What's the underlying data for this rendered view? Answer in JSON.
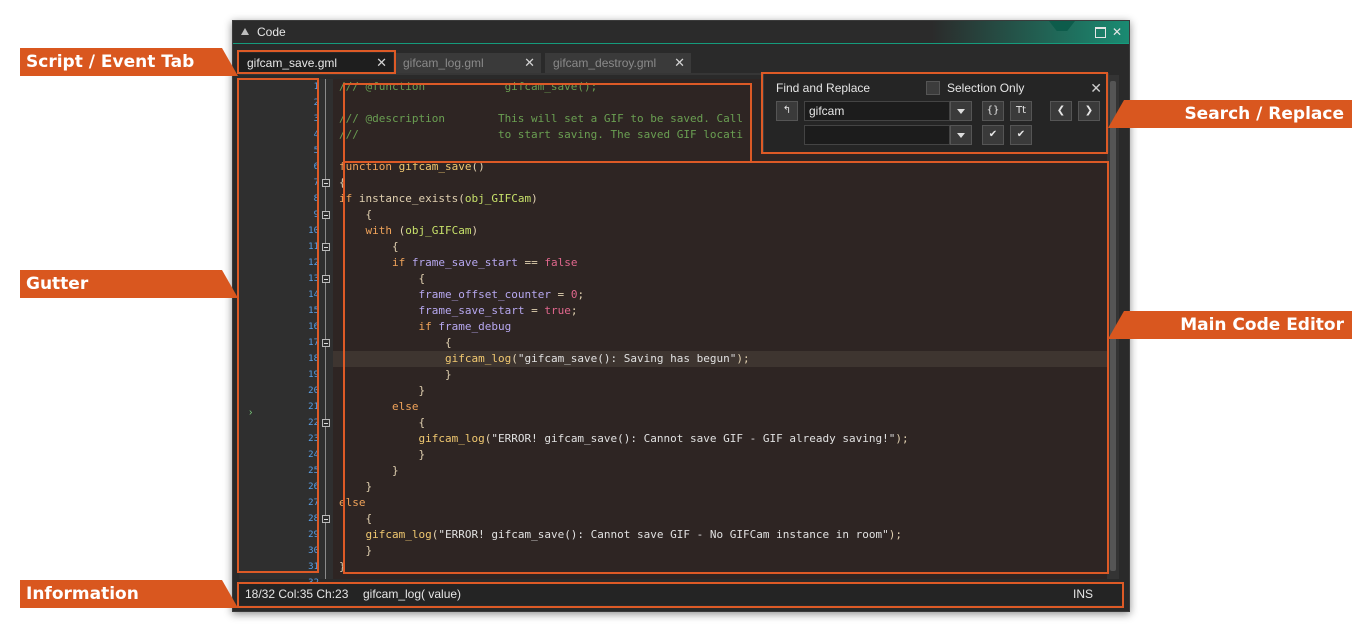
{
  "window": {
    "title": "Code",
    "close_glyph": "✕"
  },
  "tabs": [
    {
      "label": "gifcam_save.gml",
      "close": "✕",
      "active": true
    },
    {
      "label": "gifcam_log.gml",
      "close": "✕",
      "active": false
    },
    {
      "label": "gifcam_destroy.gml",
      "close": "✕",
      "active": false
    }
  ],
  "line_numbers": [
    "1",
    "2",
    "3",
    "4",
    "5",
    "6",
    "7",
    "8",
    "9",
    "10",
    "11",
    "12",
    "13",
    "14",
    "15",
    "16",
    "17",
    "18",
    "19",
    "20",
    "21",
    "22",
    "23",
    "24",
    "25",
    "26",
    "27",
    "28",
    "29",
    "30",
    "31",
    "32"
  ],
  "code_lines": [
    "/// @function            gifcam_save();",
    "",
    "/// @description        This will set a GIF to be saved. Call",
    "///                     to start saving. The saved GIF locati",
    "",
    "function gifcam_save()",
    "{",
    "if instance_exists(obj_GIFCam)",
    "    {",
    "    with (obj_GIFCam)",
    "        {",
    "        if frame_save_start == false",
    "            {",
    "            frame_offset_counter = 0;",
    "            frame_save_start = true;",
    "            if frame_debug",
    "                {",
    "                gifcam_log(\"gifcam_save(): Saving has begun\");",
    "                }",
    "            }",
    "        else",
    "            {",
    "            gifcam_log(\"ERROR! gifcam_save(): Cannot save GIF - GIF already saving!\");",
    "            }",
    "        }",
    "    }",
    "else",
    "    {",
    "    gifcam_log(\"ERROR! gifcam_save(): Cannot save GIF - No GIFCam instance in room\");",
    "    }",
    "}",
    ""
  ],
  "find_panel": {
    "title": "Find and Replace",
    "selection_only_label": "Selection Only",
    "close": "✕",
    "search_value": "gifcam",
    "replace_value": "",
    "braces_button": "{}",
    "case_button": "Tt",
    "prev_button": "❮",
    "next_button": "❯",
    "replace_button": "✔",
    "replace_all_button": "✔",
    "regex_button": "↰"
  },
  "status": {
    "position": "18/32 Col:35 Ch:23",
    "hint": "gifcam_log( value)",
    "mode": "INS"
  },
  "callouts": {
    "script_tab": "Script / Event Tab",
    "gutter": "Gutter",
    "information": "Information",
    "search_replace": "Search / Replace",
    "main_editor": "Main Code Editor"
  },
  "colors": {
    "callout": "#d9571f",
    "editor_bg": "#2e2523",
    "accent": "#1a8b72"
  }
}
